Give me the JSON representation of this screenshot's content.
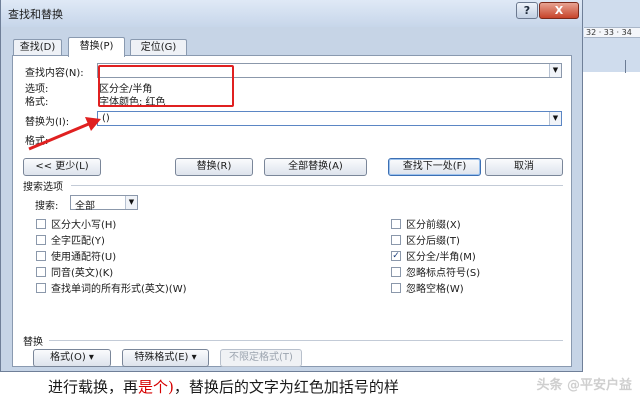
{
  "window": {
    "title": "查找和替换",
    "help_label": "?",
    "close_label": "X"
  },
  "ruler": {
    "text": "32 · 33 · 34"
  },
  "tabs": [
    {
      "label": "查找(D)",
      "active": false
    },
    {
      "label": "替换(P)",
      "active": true
    },
    {
      "label": "定位(G)",
      "active": false
    }
  ],
  "find": {
    "label": "查找内容(N):",
    "value": "",
    "options_label": "选项:",
    "options_value": "区分全/半角",
    "format_label": "格式:",
    "format_value": "字体颜色: 红色"
  },
  "replace": {
    "label": "替换为(I):",
    "value": "()",
    "format_label": "格式:"
  },
  "buttons": {
    "less": "<< 更少(L)",
    "replace": "替换(R)",
    "replace_all": "全部替换(A)",
    "find_next": "查找下一处(F)",
    "cancel": "取消"
  },
  "search_options": {
    "title": "搜索选项",
    "search_label": "搜索:",
    "search_value": "全部",
    "left": [
      {
        "label": "区分大小写(H)",
        "checked": false
      },
      {
        "label": "全字匹配(Y)",
        "checked": false
      },
      {
        "label": "使用通配符(U)",
        "checked": false
      },
      {
        "label": "同音(英文)(K)",
        "checked": false
      },
      {
        "label": "查找单词的所有形式(英文)(W)",
        "checked": false
      }
    ],
    "right": [
      {
        "label": "区分前缀(X)",
        "checked": false
      },
      {
        "label": "区分后缀(T)",
        "checked": false
      },
      {
        "label": "区分全/半角(M)",
        "checked": true
      },
      {
        "label": "忽略标点符号(S)",
        "checked": false
      },
      {
        "label": "忽略空格(W)",
        "checked": false
      }
    ]
  },
  "replace_section": {
    "title": "替换",
    "format_button": "格式(O) ▾",
    "special_button": "特殊格式(E) ▾",
    "no_format_button": "不限定格式(T)"
  },
  "document": {
    "text_before": "进行载换，再",
    "text_red": "是个)",
    "text_after": "，替换后的文字为红色加括号的样",
    "watermark": "头条 @平安户益"
  },
  "colors": {
    "annotation_red": "#e02020",
    "dialog_bg": "#c6d4e6"
  }
}
